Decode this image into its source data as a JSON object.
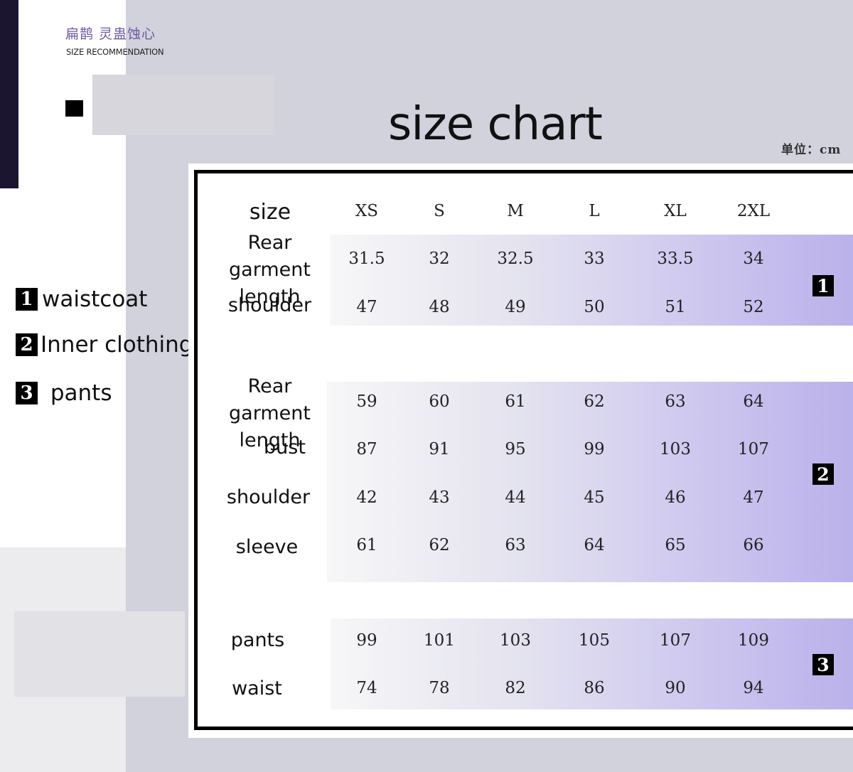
{
  "brand": {
    "name": "扁鹊 灵蛊蚀心",
    "subtitle": "SIZE RECOMMENDATION"
  },
  "title": "size chart",
  "unit": "单位：cm",
  "legend": [
    {
      "num": "1",
      "label": "waistcoat"
    },
    {
      "num": "2",
      "label": "Inner clothing"
    },
    {
      "num": "3",
      "label": " pants"
    }
  ],
  "table": {
    "size_label": "size",
    "sizes": [
      "XS",
      "S",
      "M",
      "L",
      "XL",
      "2XL"
    ],
    "groups": [
      {
        "badge": "1",
        "rows": [
          {
            "label_lines": [
              "Rear garment",
              "length"
            ],
            "values": [
              "31.5",
              "32",
              "32.5",
              "33",
              "33.5",
              "34"
            ]
          },
          {
            "label_lines": [
              "shoulder"
            ],
            "values": [
              "47",
              "48",
              "49",
              "50",
              "51",
              "52"
            ]
          }
        ]
      },
      {
        "badge": "2",
        "rows": [
          {
            "label_lines": [
              "Rear garment",
              "length"
            ],
            "values": [
              "59",
              "60",
              "61",
              "62",
              "63",
              "64"
            ]
          },
          {
            "label_lines": [
              "bust"
            ],
            "values": [
              "87",
              "91",
              "95",
              "99",
              "103",
              "107"
            ]
          },
          {
            "label_lines": [
              "shoulder"
            ],
            "values": [
              "42",
              "43",
              "44",
              "45",
              "46",
              "47"
            ]
          },
          {
            "label_lines": [
              "sleeve"
            ],
            "values": [
              "61",
              "62",
              "63",
              "64",
              "65",
              "66"
            ]
          }
        ]
      },
      {
        "badge": "3",
        "rows": [
          {
            "label_lines": [
              "pants"
            ],
            "values": [
              "99",
              "101",
              "103",
              "105",
              "107",
              "109"
            ]
          },
          {
            "label_lines": [
              "waist"
            ],
            "values": [
              "74",
              "78",
              "82",
              "86",
              "90",
              "94"
            ]
          }
        ]
      }
    ]
  }
}
